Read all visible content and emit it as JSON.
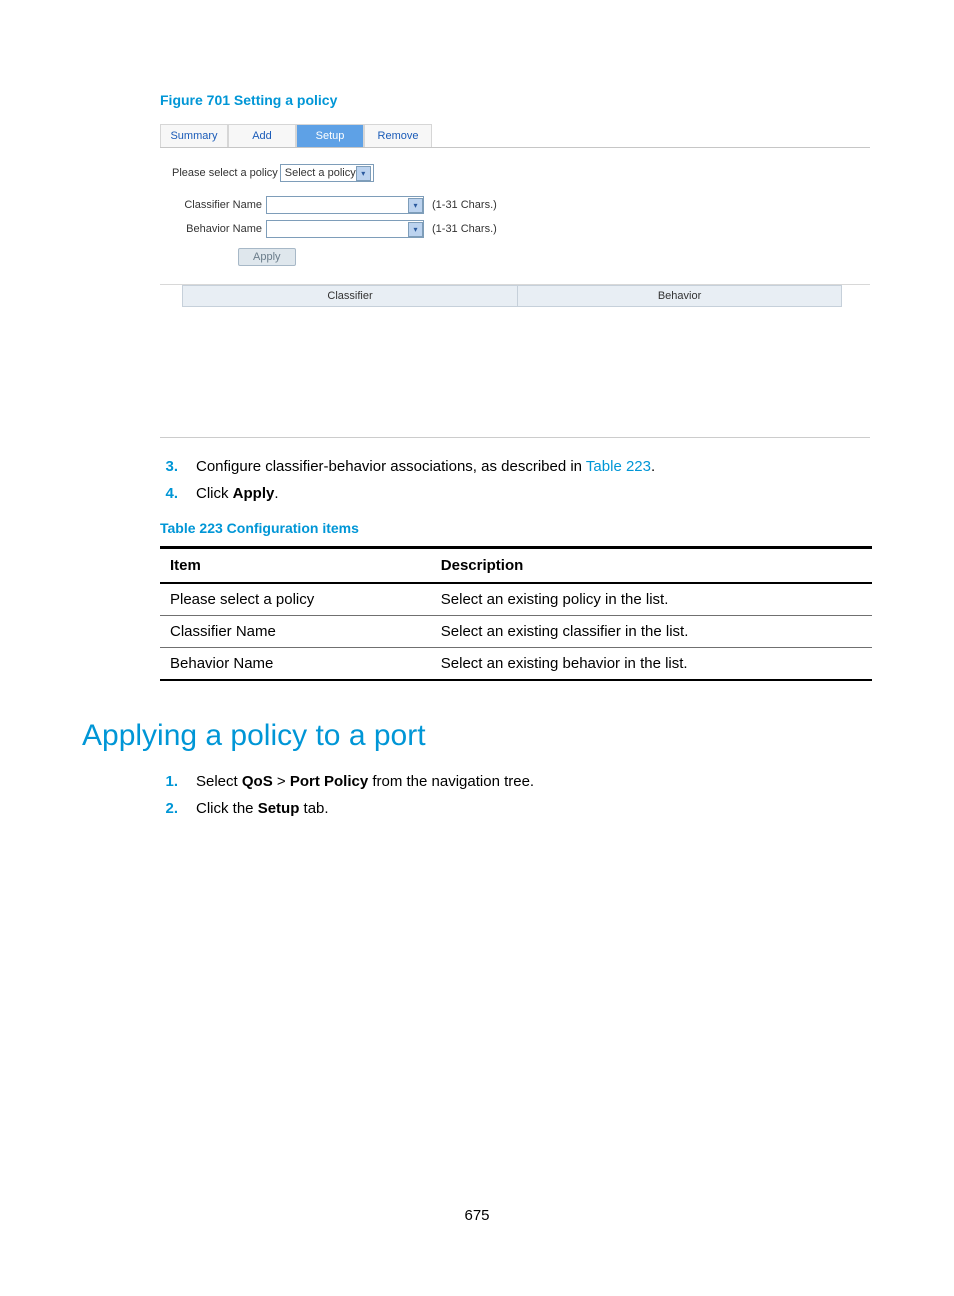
{
  "figure": {
    "caption": "Figure 701 Setting a policy",
    "tabs": [
      "Summary",
      "Add",
      "Setup",
      "Remove"
    ],
    "active_tab_index": 2,
    "policy_label": "Please select a policy",
    "policy_select_value": "Select a policy",
    "rows": [
      {
        "label": "Classifier Name",
        "hint": "(1-31 Chars.)"
      },
      {
        "label": "Behavior Name",
        "hint": "(1-31 Chars.)"
      }
    ],
    "apply_label": "Apply",
    "result_headers": [
      "Classifier",
      "Behavior"
    ]
  },
  "steps_a": [
    {
      "num": "3.",
      "pre": "Configure classifier-behavior associations, as described in ",
      "link": "Table 223",
      "post": "."
    },
    {
      "num": "4.",
      "pre": "Click ",
      "bold": "Apply",
      "post": "."
    }
  ],
  "table_caption": "Table 223 Configuration items",
  "table": {
    "headers": [
      "Item",
      "Description"
    ],
    "rows": [
      [
        "Please select a policy",
        "Select an existing policy in the list."
      ],
      [
        "Classifier Name",
        "Select an existing classifier in the list."
      ],
      [
        "Behavior Name",
        "Select an existing behavior in the list."
      ]
    ]
  },
  "heading": "Applying a policy to a port",
  "steps_b": [
    {
      "num": "1.",
      "parts": [
        "Select ",
        "QoS",
        " > ",
        "Port Policy",
        " from the navigation tree."
      ],
      "bold_idx": [
        1,
        3
      ]
    },
    {
      "num": "2.",
      "parts": [
        "Click the ",
        "Setup",
        " tab."
      ],
      "bold_idx": [
        1
      ]
    }
  ],
  "page_number": "675"
}
